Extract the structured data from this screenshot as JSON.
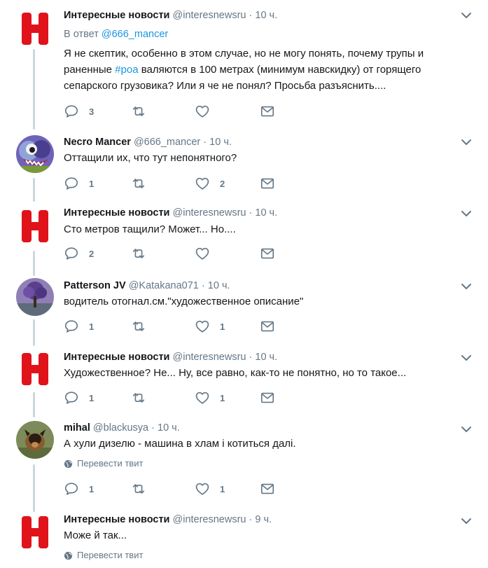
{
  "tweets": [
    {
      "name": "Интересные новости",
      "handle": "@interesnewsru",
      "dot": "·",
      "time": "10 ч.",
      "reply_prefix": "В ответ",
      "reply_handle": "@666_mancer",
      "text_a": "Я не скептик, особенно в этом случае, но не могу понять, почему трупы и",
      "text_b_pre": "раненные ",
      "text_b_tag": "#роа",
      "text_b_post": " валяются в 100 метрах (минимум навскидку) от горящего",
      "text_c": "сепарского грузовика? Или я че не понял? Просьба разъяснить....",
      "replies": "3",
      "retweets": "",
      "likes": ""
    },
    {
      "name": "Necro Mancer",
      "handle": "@666_mancer",
      "dot": "·",
      "time": "10 ч.",
      "text": "Оттащили их, что тут непонятного?",
      "replies": "1",
      "retweets": "",
      "likes": "2"
    },
    {
      "name": "Интересные новости",
      "handle": "@interesnewsru",
      "dot": "·",
      "time": "10 ч.",
      "text": "Сто метров тащили? Может... Но....",
      "replies": "2",
      "retweets": "",
      "likes": ""
    },
    {
      "name": "Patterson JV",
      "handle": "@Katakana071",
      "dot": "·",
      "time": "10 ч.",
      "text": "водитель отогнал.см.\"художественное описание\"",
      "replies": "1",
      "retweets": "",
      "likes": "1"
    },
    {
      "name": "Интересные новости",
      "handle": "@interesnewsru",
      "dot": "·",
      "time": "10 ч.",
      "text": "Художественное? Не... Ну, все равно, как-то не понятно, но то такое...",
      "replies": "1",
      "retweets": "",
      "likes": "1"
    },
    {
      "name": "mihal",
      "handle": "@blackusya",
      "dot": "·",
      "time": "10 ч.",
      "text": "А хули дизелю -  машина в хлам і котиться далі.",
      "translate": "Перевести твит",
      "replies": "1",
      "retweets": "",
      "likes": "1"
    },
    {
      "name": "Интересные новости",
      "handle": "@interesnewsru",
      "dot": "·",
      "time": "9 ч.",
      "text": "Може й так...",
      "translate": "Перевести твит"
    }
  ],
  "colors": {
    "brand_red": "#e0131b",
    "link": "#1b95e0",
    "muted": "#657786",
    "thread_line": "#ccd6dd"
  },
  "icons": [
    "reply-icon",
    "retweet-icon",
    "like-icon",
    "dm-icon",
    "chevron-down-icon",
    "globe-icon"
  ]
}
